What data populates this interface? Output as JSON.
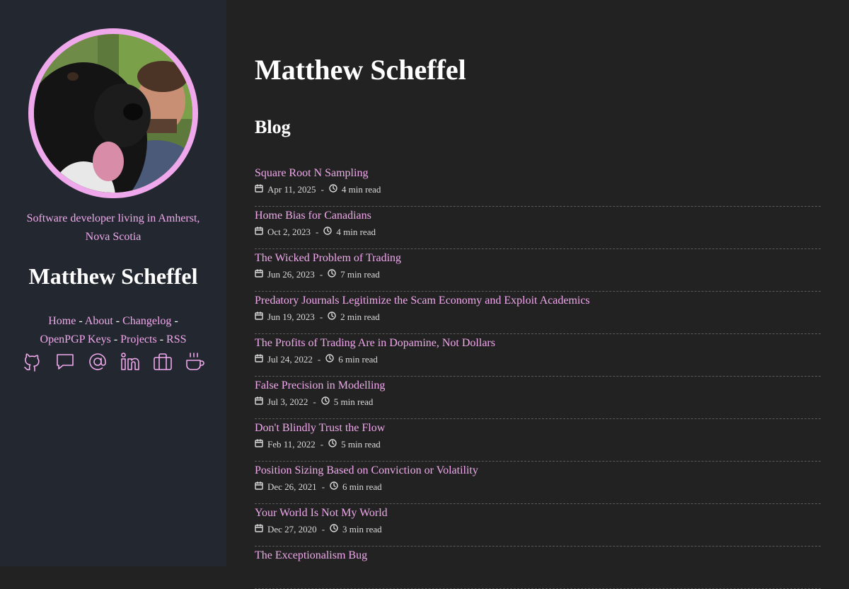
{
  "sidebar": {
    "tagline": "Software developer living in Amherst, Nova Scotia",
    "name": "Matthew Scheffel",
    "links": [
      "Home",
      "About",
      "Changelog",
      "OpenPGP Keys",
      "Projects",
      "RSS"
    ],
    "separator": "-",
    "social_icons": [
      "github-icon",
      "chat-icon",
      "email-icon",
      "linkedin-icon",
      "briefcase-icon",
      "coffee-icon"
    ]
  },
  "main": {
    "title": "Matthew Scheffel",
    "section_heading": "Blog",
    "posts": [
      {
        "title": "Square Root N Sampling",
        "date": "Apr 11, 2025",
        "read_time": "4 min read"
      },
      {
        "title": "Home Bias for Canadians",
        "date": "Oct 2, 2023",
        "read_time": "4 min read"
      },
      {
        "title": "The Wicked Problem of Trading",
        "date": "Jun 26, 2023",
        "read_time": "7 min read"
      },
      {
        "title": "Predatory Journals Legitimize the Scam Economy and Exploit Academics",
        "date": "Jun 19, 2023",
        "read_time": "2 min read"
      },
      {
        "title": "The Profits of Trading Are in Dopamine, Not Dollars",
        "date": "Jul 24, 2022",
        "read_time": "6 min read"
      },
      {
        "title": "False Precision in Modelling",
        "date": "Jul 3, 2022",
        "read_time": "5 min read"
      },
      {
        "title": "Don't Blindly Trust the Flow",
        "date": "Feb 11, 2022",
        "read_time": "5 min read"
      },
      {
        "title": "Position Sizing Based on Conviction or Volatility",
        "date": "Dec 26, 2021",
        "read_time": "6 min read"
      },
      {
        "title": "Your World Is Not My World",
        "date": "Dec 27, 2020",
        "read_time": "3 min read"
      },
      {
        "title": "The Exceptionalism Bug",
        "date": "",
        "read_time": ""
      }
    ]
  },
  "colors": {
    "accent": "#f0a8ec",
    "sidebar_bg": "#232830",
    "main_bg": "#222222",
    "text": "#ffffff"
  }
}
